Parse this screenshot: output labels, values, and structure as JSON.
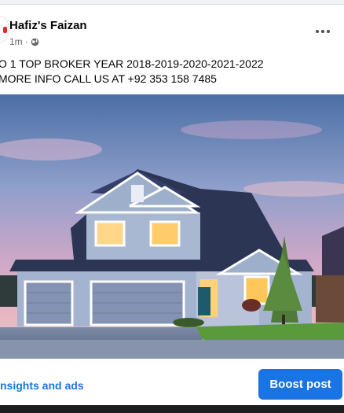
{
  "post": {
    "author": "Hafiz's Faizan",
    "time": "1m",
    "separator": "·",
    "privacy_icon": "globe-icon",
    "more_icon": "more-options-icon",
    "text_line1": "O 1 TOP BROKER YEAR 2018-2019-2020-2021-2022",
    "text_line2": "MORE INFO CALL US AT +92 353 158 7485",
    "photo": "house-at-dusk-photo"
  },
  "footer": {
    "insights_label": "nsights and ads",
    "boost_label": "Boost post"
  },
  "colors": {
    "accent": "#1b74e4",
    "text": "#050505",
    "muted": "#65676b",
    "background": "#f0f2f5"
  }
}
